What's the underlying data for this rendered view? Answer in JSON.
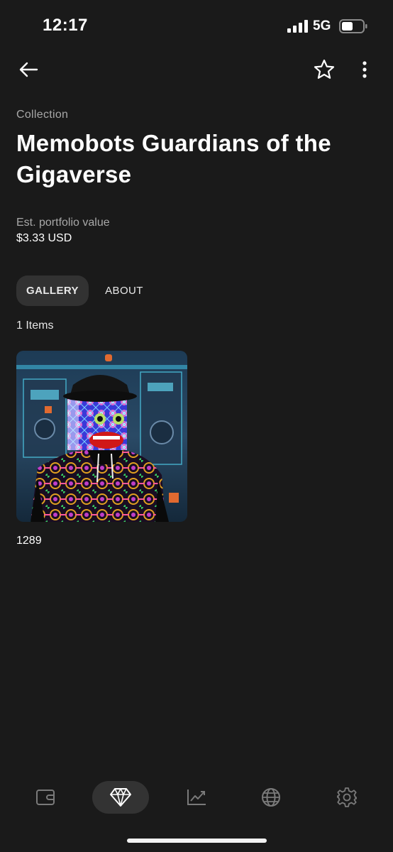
{
  "status_bar": {
    "time": "12:17",
    "network": "5G"
  },
  "header": {
    "back_icon": "arrow-left-icon",
    "favorite_icon": "star-outline-icon",
    "more_icon": "vertical-ellipsis-icon"
  },
  "collection": {
    "eyebrow": "Collection",
    "title": "Memobots Guardians of the Gigaverse",
    "portfolio_label": "Est. portfolio value",
    "portfolio_value": "$3.33 USD"
  },
  "tabs": [
    {
      "label": "GALLERY",
      "active": true
    },
    {
      "label": "ABOUT",
      "active": false
    }
  ],
  "gallery": {
    "count_label": "1 Items",
    "items": [
      {
        "name": "1289"
      }
    ]
  },
  "tab_bar": {
    "items": [
      {
        "icon": "wallet-icon",
        "active": false
      },
      {
        "icon": "diamond-icon",
        "active": true
      },
      {
        "icon": "chart-icon",
        "active": false
      },
      {
        "icon": "globe-icon",
        "active": false
      },
      {
        "icon": "gear-icon",
        "active": false
      }
    ]
  },
  "colors": {
    "background": "#1a1a1a",
    "active_pill": "#333333",
    "secondary_text": "#a8a8a8"
  }
}
